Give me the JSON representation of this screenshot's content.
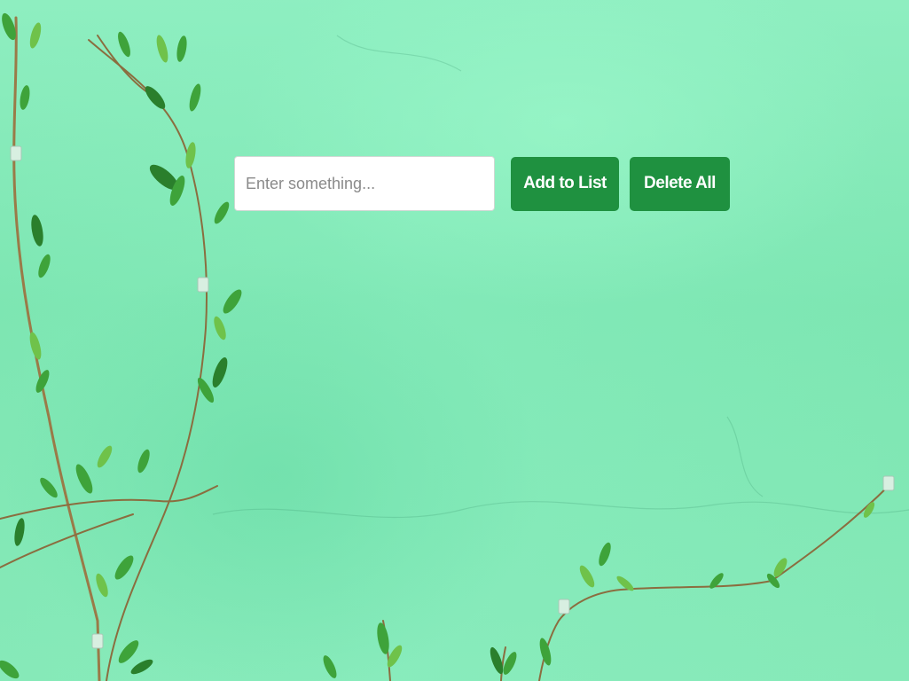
{
  "todo_form": {
    "input_placeholder": "Enter something...",
    "input_value": "",
    "add_button_label": "Add to List",
    "delete_all_button_label": "Delete All"
  },
  "colors": {
    "background": "#7de8b4",
    "button": "#1f9140",
    "button_text": "#ffffff"
  },
  "background_image": "green wall with climbing vine"
}
